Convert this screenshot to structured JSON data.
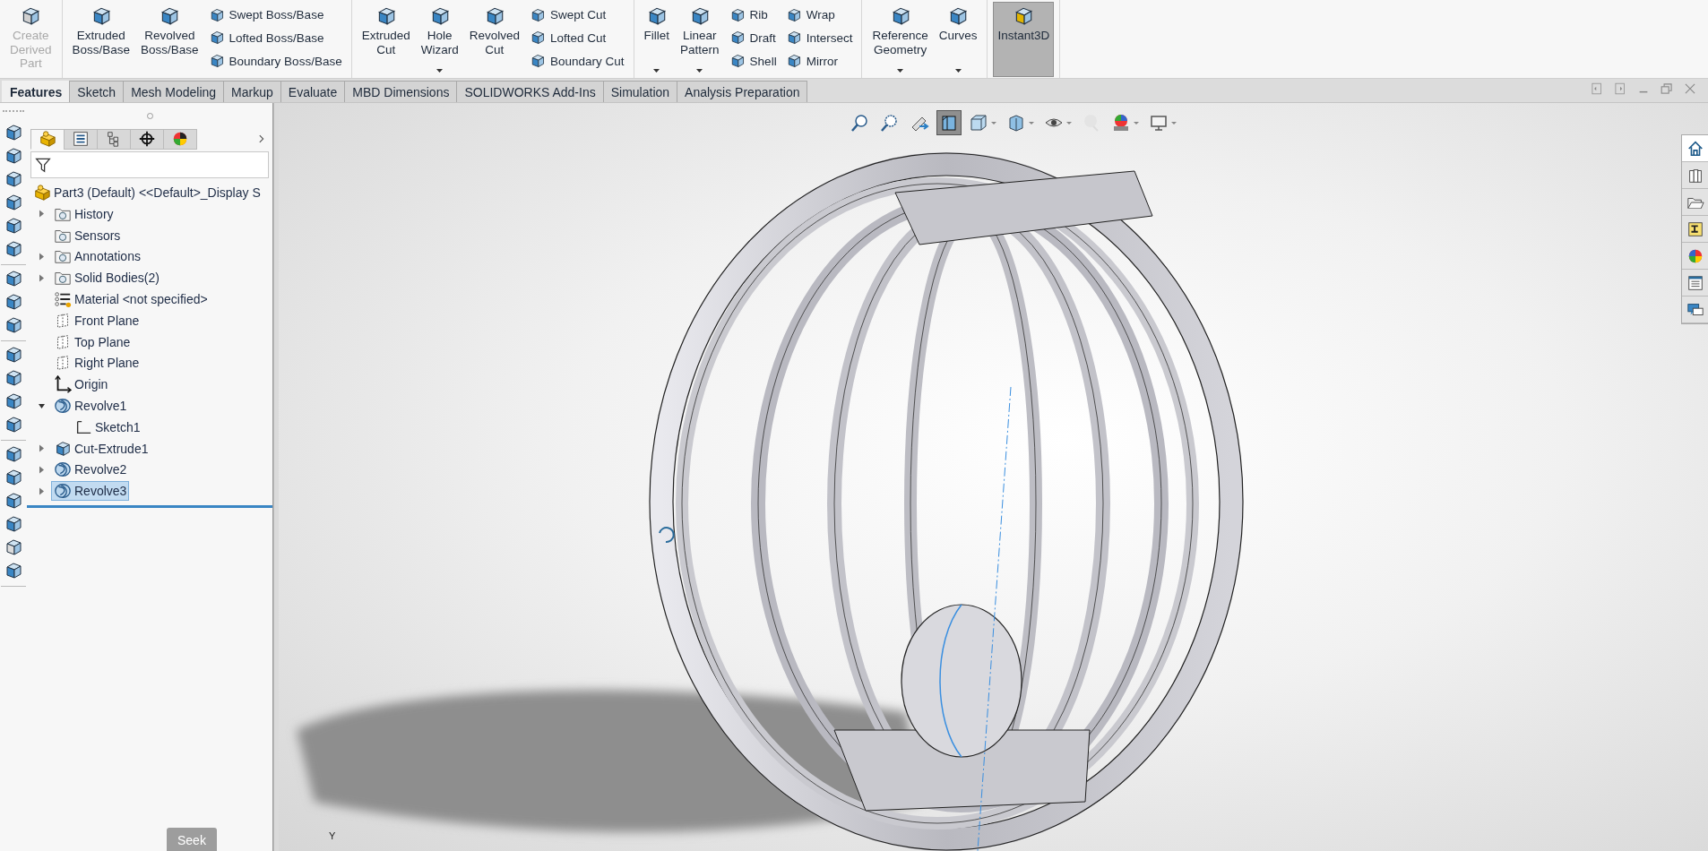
{
  "ribbon": {
    "sections": [
      {
        "items": [
          {
            "kind": "large",
            "label": "Create Derived Part",
            "disabled": true,
            "on": false,
            "dropdown": false
          }
        ]
      },
      {
        "items": [
          {
            "kind": "large",
            "label": "Extruded Boss/Base",
            "disabled": false,
            "on": false,
            "dropdown": false
          },
          {
            "kind": "large",
            "label": "Revolved Boss/Base",
            "disabled": false,
            "on": false,
            "dropdown": false
          },
          {
            "kind": "stack",
            "labels": [
              "Swept Boss/Base",
              "Lofted Boss/Base",
              "Boundary Boss/Base"
            ]
          }
        ]
      },
      {
        "items": [
          {
            "kind": "large",
            "label": "Extruded Cut",
            "disabled": false,
            "on": false,
            "dropdown": false
          },
          {
            "kind": "large",
            "label": "Hole Wizard",
            "disabled": false,
            "on": false,
            "dropdown": true
          },
          {
            "kind": "large",
            "label": "Revolved Cut",
            "disabled": false,
            "on": false,
            "dropdown": false
          },
          {
            "kind": "stack",
            "labels": [
              "Swept Cut",
              "Lofted Cut",
              "Boundary Cut"
            ]
          }
        ]
      },
      {
        "items": [
          {
            "kind": "large",
            "label": "Fillet",
            "disabled": false,
            "on": false,
            "dropdown": true
          },
          {
            "kind": "large",
            "label": "Linear Pattern",
            "disabled": false,
            "on": false,
            "dropdown": true
          },
          {
            "kind": "stack",
            "labels": [
              "Rib",
              "Draft",
              "Shell"
            ]
          },
          {
            "kind": "stack",
            "labels": [
              "Wrap",
              "Intersect",
              "Mirror"
            ]
          }
        ]
      },
      {
        "items": [
          {
            "kind": "large",
            "label": "Reference Geometry",
            "disabled": false,
            "on": false,
            "dropdown": true
          },
          {
            "kind": "large",
            "label": "Curves",
            "disabled": false,
            "on": false,
            "dropdown": true
          }
        ]
      },
      {
        "items": [
          {
            "kind": "large",
            "label": "Instant3D",
            "disabled": false,
            "on": true,
            "dropdown": false
          }
        ]
      }
    ]
  },
  "tabs": [
    {
      "label": "Features",
      "selected": true
    },
    {
      "label": "Sketch",
      "selected": false
    },
    {
      "label": "Mesh Modeling",
      "selected": false
    },
    {
      "label": "Markup",
      "selected": false
    },
    {
      "label": "Evaluate",
      "selected": false
    },
    {
      "label": "MBD Dimensions",
      "selected": false
    },
    {
      "label": "SOLIDWORKS Add-Ins",
      "selected": false
    },
    {
      "label": "Simulation",
      "selected": false
    },
    {
      "label": "Analysis Preparation",
      "selected": false
    }
  ],
  "left_strip": [
    [
      {
        "disabled": false
      },
      {
        "disabled": false
      },
      {
        "disabled": false
      },
      {
        "disabled": false
      },
      {
        "disabled": false
      },
      {
        "disabled": false
      }
    ],
    [
      {
        "disabled": false
      },
      {
        "disabled": false
      },
      {
        "disabled": false
      }
    ],
    [
      {
        "disabled": false
      },
      {
        "disabled": false
      },
      {
        "disabled": false
      },
      {
        "disabled": false
      }
    ],
    [
      {
        "disabled": false
      },
      {
        "disabled": false
      },
      {
        "disabled": false
      },
      {
        "disabled": false
      },
      {
        "disabled": true
      },
      {
        "disabled": false
      }
    ]
  ],
  "panel_tabs": [
    {
      "selected": true
    },
    {
      "selected": false
    },
    {
      "selected": false
    },
    {
      "selected": false
    },
    {
      "selected": false
    }
  ],
  "feature_tree": {
    "root": {
      "label": "Part3 (Default) <<Default>_Display S",
      "kind": "part"
    },
    "items": [
      {
        "label": "History",
        "kind": "folder",
        "expanded": false,
        "selected": false
      },
      {
        "label": "Sensors",
        "kind": "folder",
        "selected": false
      },
      {
        "label": "Annotations",
        "kind": "folder",
        "expanded": false,
        "selected": false
      },
      {
        "label": "Solid Bodies(2)",
        "kind": "folder",
        "expanded": false,
        "selected": false
      },
      {
        "label": "Material <not specified>",
        "kind": "material",
        "selected": false
      },
      {
        "label": "Front Plane",
        "kind": "plane",
        "selected": false
      },
      {
        "label": "Top Plane",
        "kind": "plane",
        "selected": false
      },
      {
        "label": "Right Plane",
        "kind": "plane",
        "selected": false
      },
      {
        "label": "Origin",
        "kind": "origin",
        "selected": false
      },
      {
        "label": "Revolve1",
        "kind": "revolve",
        "expanded": true,
        "selected": false,
        "children": [
          {
            "label": "Sketch1",
            "kind": "sketch",
            "selected": false
          }
        ]
      },
      {
        "label": "Cut-Extrude1",
        "kind": "cut",
        "expanded": false,
        "selected": false
      },
      {
        "label": "Revolve2",
        "kind": "revolve",
        "expanded": false,
        "selected": false
      },
      {
        "label": "Revolve3",
        "kind": "revolve",
        "expanded": false,
        "selected": true
      }
    ]
  },
  "seek_button": "Seek",
  "view_toolbar": [
    {
      "selected": false,
      "dropdown": false
    },
    {
      "selected": false,
      "dropdown": false
    },
    {
      "selected": false,
      "dropdown": false
    },
    {
      "selected": true,
      "dropdown": false
    },
    {
      "selected": false,
      "dropdown": true
    },
    {
      "selected": false,
      "dropdown": true
    },
    {
      "selected": false,
      "dropdown": true
    },
    {
      "selected": false,
      "dropdown": false
    },
    {
      "selected": false,
      "dropdown": true
    },
    {
      "selected": false,
      "dropdown": true
    }
  ],
  "task_pane": [
    {
      "selected": true
    },
    {
      "selected": false
    },
    {
      "selected": false
    },
    {
      "selected": false
    },
    {
      "selected": false
    },
    {
      "selected": false
    },
    {
      "selected": false
    }
  ],
  "triad_label": "Y"
}
